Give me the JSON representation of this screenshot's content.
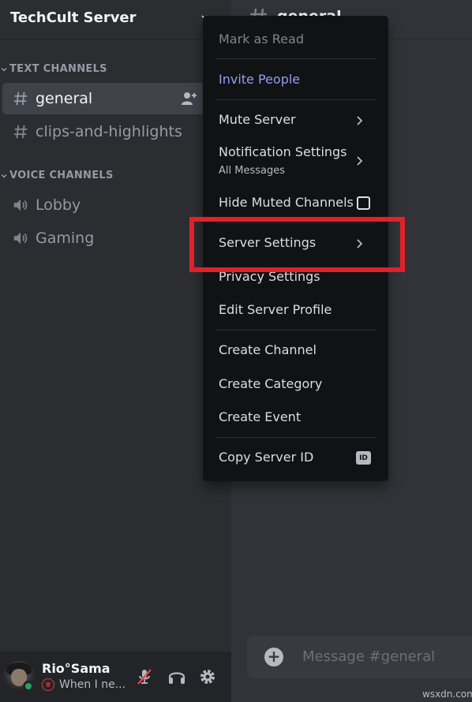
{
  "server": {
    "name": "TechCult Server"
  },
  "sidebar": {
    "text_category": "TEXT CHANNELS",
    "voice_category": "VOICE CHANNELS",
    "text_channels": [
      {
        "name": "general",
        "active": true
      },
      {
        "name": "clips-and-highlights",
        "active": false
      }
    ],
    "voice_channels": [
      {
        "name": "Lobby"
      },
      {
        "name": "Gaming"
      }
    ]
  },
  "user": {
    "name": "Rio°Sama",
    "status": "When I ne..."
  },
  "main": {
    "channel_title": "general",
    "message_placeholder": "Message #general"
  },
  "menu": {
    "mark_as_read": "Mark as Read",
    "invite_people": "Invite People",
    "mute_server": "Mute Server",
    "notification_settings": "Notification Settings",
    "notification_sub": "All Messages",
    "hide_muted": "Hide Muted Channels",
    "hide_muted_checked": false,
    "server_settings": "Server Settings",
    "privacy_settings": "Privacy Settings",
    "edit_profile": "Edit Server Profile",
    "create_channel": "Create Channel",
    "create_category": "Create Category",
    "create_event": "Create Event",
    "copy_id": "Copy Server ID",
    "id_badge": "ID"
  },
  "watermark": "wsxdn.com",
  "colors": {
    "accent": "#949cf7",
    "highlight": "#e0212a",
    "online": "#23a55a"
  }
}
